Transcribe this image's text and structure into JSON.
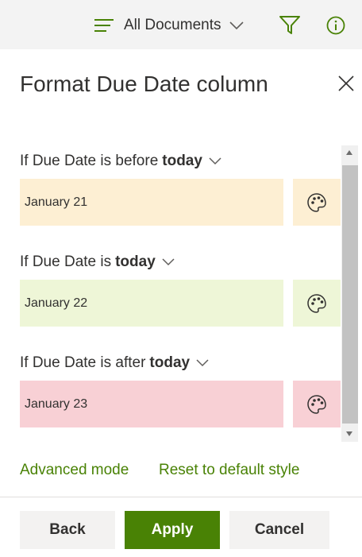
{
  "colors": {
    "accent": "#498205",
    "rule_before_bg": "#fdefd3",
    "rule_today_bg": "#eef6d7",
    "rule_after_bg": "#f8d0d5",
    "text": "#323130"
  },
  "toolbar": {
    "view_label": "All Documents",
    "view_icon": "lines-icon",
    "filter_icon": "filter-icon",
    "info_icon": "info-icon"
  },
  "panel": {
    "title": "Format Due Date column",
    "close_icon": "close-icon"
  },
  "rules": [
    {
      "prefix": "If Due Date is before",
      "keyword": "today",
      "value": "January 21",
      "bg": "#fdefd3"
    },
    {
      "prefix": "If Due Date is",
      "keyword": "today",
      "value": "January 22",
      "bg": "#eef6d7"
    },
    {
      "prefix": "If Due Date is after",
      "keyword": "today",
      "value": "January 23",
      "bg": "#f8d0d5"
    }
  ],
  "links": {
    "advanced": "Advanced mode",
    "reset": "Reset to default style"
  },
  "buttons": {
    "back": "Back",
    "apply": "Apply",
    "cancel": "Cancel"
  }
}
